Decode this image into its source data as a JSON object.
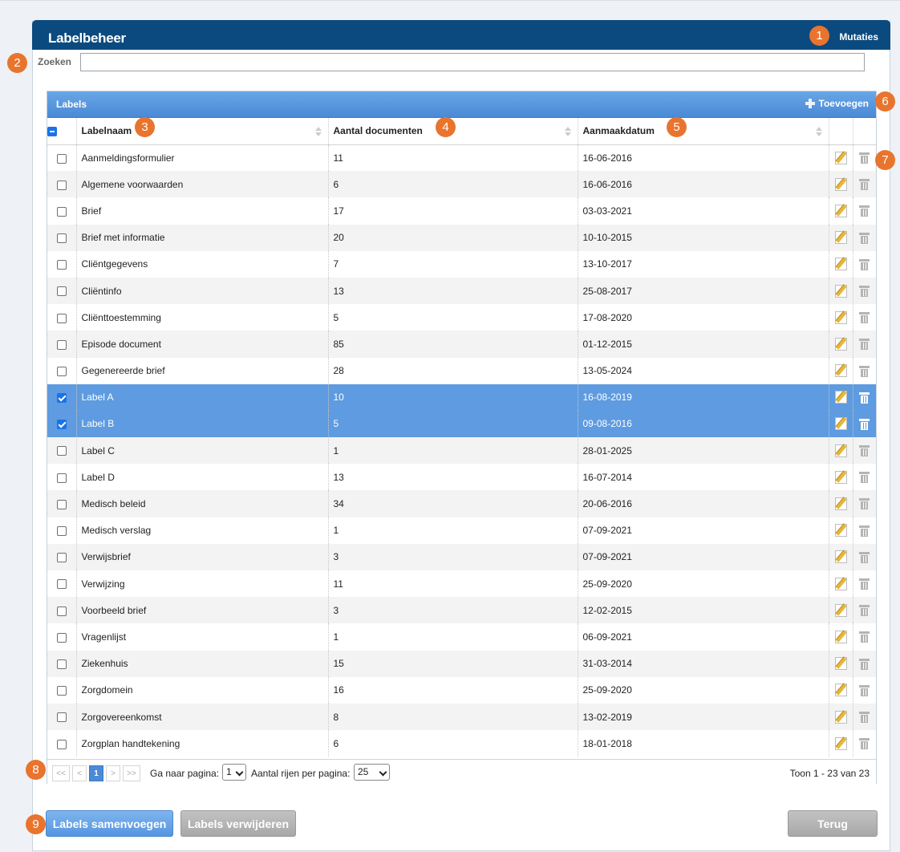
{
  "header": {
    "title": "Labelbeheer",
    "mutaties_label": "Mutaties"
  },
  "search": {
    "label": "Zoeken",
    "value": "",
    "placeholder": ""
  },
  "grid": {
    "caption": "Labels",
    "add_label": "Toevoegen",
    "columns": {
      "name": "Labelnaam",
      "count": "Aantal documenten",
      "date": "Aanmaakdatum"
    },
    "rows": [
      {
        "name": "Aanmeldingsformulier",
        "count": "11",
        "date": "16-06-2016",
        "selected": false
      },
      {
        "name": "Algemene voorwaarden",
        "count": "6",
        "date": "16-06-2016",
        "selected": false
      },
      {
        "name": "Brief",
        "count": "17",
        "date": "03-03-2021",
        "selected": false
      },
      {
        "name": "Brief met informatie",
        "count": "20",
        "date": "10-10-2015",
        "selected": false
      },
      {
        "name": "Cliëntgegevens",
        "count": "7",
        "date": "13-10-2017",
        "selected": false
      },
      {
        "name": "Cliëntinfo",
        "count": "13",
        "date": "25-08-2017",
        "selected": false
      },
      {
        "name": "Cliënttoestemming",
        "count": "5",
        "date": "17-08-2020",
        "selected": false
      },
      {
        "name": "Episode document",
        "count": "85",
        "date": "01-12-2015",
        "selected": false
      },
      {
        "name": "Gegenereerde brief",
        "count": "28",
        "date": "13-05-2024",
        "selected": false
      },
      {
        "name": "Label A",
        "count": "10",
        "date": "16-08-2019",
        "selected": true
      },
      {
        "name": "Label B",
        "count": "5",
        "date": "09-08-2016",
        "selected": true
      },
      {
        "name": "Label C",
        "count": "1",
        "date": "28-01-2025",
        "selected": false
      },
      {
        "name": "Label D",
        "count": "13",
        "date": "16-07-2014",
        "selected": false
      },
      {
        "name": "Medisch beleid",
        "count": "34",
        "date": "20-06-2016",
        "selected": false
      },
      {
        "name": "Medisch verslag",
        "count": "1",
        "date": "07-09-2021",
        "selected": false
      },
      {
        "name": "Verwijsbrief",
        "count": "3",
        "date": "07-09-2021",
        "selected": false
      },
      {
        "name": "Verwijzing",
        "count": "11",
        "date": "25-09-2020",
        "selected": false
      },
      {
        "name": "Voorbeeld brief",
        "count": "3",
        "date": "12-02-2015",
        "selected": false
      },
      {
        "name": "Vragenlijst",
        "count": "1",
        "date": "06-09-2021",
        "selected": false
      },
      {
        "name": "Ziekenhuis",
        "count": "15",
        "date": "31-03-2014",
        "selected": false
      },
      {
        "name": "Zorgdomein",
        "count": "16",
        "date": "25-09-2020",
        "selected": false
      },
      {
        "name": "Zorgovereenkomst",
        "count": "8",
        "date": "13-02-2019",
        "selected": false
      },
      {
        "name": "Zorgplan handtekening",
        "count": "6",
        "date": "18-01-2018",
        "selected": false
      }
    ]
  },
  "pager": {
    "first": "<<",
    "prev": "<",
    "current_page": "1",
    "next": ">",
    "last": ">>",
    "goto_label": "Ga naar pagina:",
    "goto_value": "1",
    "rows_label": "Aantal rijen per pagina:",
    "rows_value": "25",
    "summary": "Toon 1 - 23 van 23"
  },
  "buttons": {
    "merge": "Labels samenvoegen",
    "delete": "Labels verwijderen",
    "back": "Terug"
  },
  "badges": [
    "1",
    "2",
    "3",
    "4",
    "5",
    "6",
    "7",
    "8",
    "9"
  ],
  "colors": {
    "header": "#0b4a7f",
    "caption": "#4a8ad6",
    "selected_row": "#5e9be0",
    "badge": "#e8742e"
  }
}
